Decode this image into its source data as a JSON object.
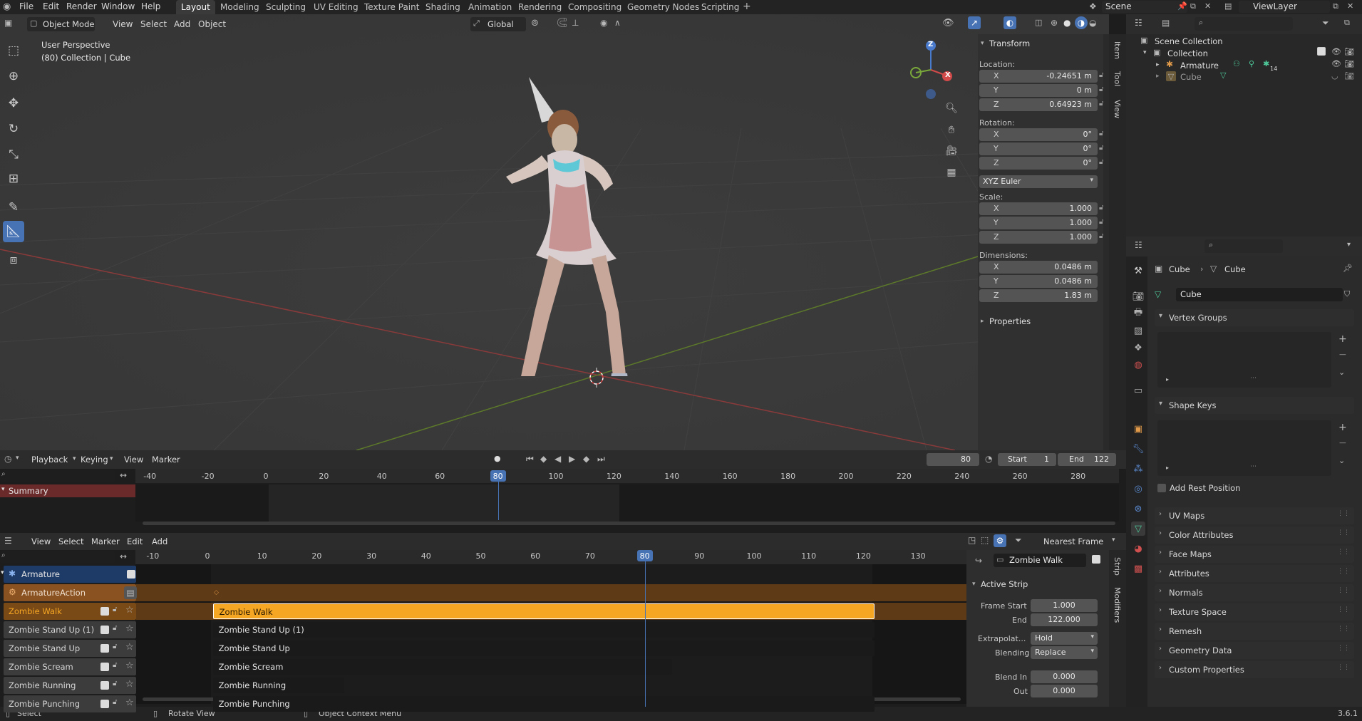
{
  "menu": [
    "File",
    "Edit",
    "Render",
    "Window",
    "Help"
  ],
  "workspaces": [
    "Layout",
    "Modeling",
    "Sculpting",
    "UV Editing",
    "Texture Paint",
    "Shading",
    "Animation",
    "Rendering",
    "Compositing",
    "Geometry Nodes",
    "Scripting"
  ],
  "active_workspace": "Layout",
  "scene": "Scene",
  "view_layer": "ViewLayer",
  "viewport": {
    "mode": "Object Mode",
    "menus": [
      "View",
      "Select",
      "Add",
      "Object"
    ],
    "orientation": "Global",
    "perspective": "User Perspective",
    "context": "(80) Collection | Cube",
    "gizmo": {
      "z": "Z",
      "x": "X"
    }
  },
  "npanel": {
    "tabs": [
      "Item",
      "Tool",
      "View"
    ],
    "transform_title": "Transform",
    "location_label": "Location:",
    "location": [
      {
        "axis": "X",
        "value": "-0.24651 m"
      },
      {
        "axis": "Y",
        "value": "0 m"
      },
      {
        "axis": "Z",
        "value": "0.64923 m"
      }
    ],
    "rotation_label": "Rotation:",
    "rotation": [
      {
        "axis": "X",
        "value": "0°"
      },
      {
        "axis": "Y",
        "value": "0°"
      },
      {
        "axis": "Z",
        "value": "0°"
      }
    ],
    "rotation_mode": "XYZ Euler",
    "scale_label": "Scale:",
    "scale": [
      {
        "axis": "X",
        "value": "1.000"
      },
      {
        "axis": "Y",
        "value": "1.000"
      },
      {
        "axis": "Z",
        "value": "1.000"
      }
    ],
    "dimensions_label": "Dimensions:",
    "dimensions": [
      {
        "axis": "X",
        "value": "0.0486 m"
      },
      {
        "axis": "Y",
        "value": "0.0486 m"
      },
      {
        "axis": "Z",
        "value": "1.83 m"
      }
    ],
    "properties_title": "Properties"
  },
  "outliner": {
    "scene_collection": "Scene Collection",
    "collection": "Collection",
    "armature": "Armature",
    "armature_badge": "14",
    "cube": "Cube"
  },
  "properties": {
    "breadcrumb_obj": "Cube",
    "breadcrumb_data": "Cube",
    "mesh_name": "Cube",
    "vertex_groups": "Vertex Groups",
    "shape_keys": "Shape Keys",
    "add_rest_position": "Add Rest Position",
    "sections": [
      "UV Maps",
      "Color Attributes",
      "Face Maps",
      "Attributes",
      "Normals",
      "Texture Space",
      "Remesh",
      "Geometry Data",
      "Custom Properties"
    ]
  },
  "timeline": {
    "menus": [
      "Playback",
      "Keying",
      "View",
      "Marker"
    ],
    "current_frame": "80",
    "start_label": "Start",
    "start": "1",
    "end_label": "End",
    "end": "122",
    "ruler": [
      "-40",
      "-20",
      "0",
      "20",
      "40",
      "60",
      "80",
      "100",
      "120",
      "140",
      "160",
      "180",
      "200",
      "220",
      "240",
      "260",
      "280"
    ],
    "summary": "Summary"
  },
  "nla": {
    "menus": [
      "View",
      "Select",
      "Marker",
      "Edit",
      "Add"
    ],
    "snap": "Nearest Frame",
    "ruler": [
      "-10",
      "0",
      "10",
      "20",
      "30",
      "40",
      "50",
      "60",
      "70",
      "80",
      "90",
      "100",
      "110",
      "120",
      "130"
    ],
    "current_frame": "80",
    "tracks": [
      {
        "name": "Armature"
      },
      {
        "name": "ArmatureAction"
      },
      {
        "name": "Zombie Walk"
      },
      {
        "name": "Zombie Stand Up (1)"
      },
      {
        "name": "Zombie Stand Up"
      },
      {
        "name": "Zombie Scream"
      },
      {
        "name": "Zombie Running"
      },
      {
        "name": "Zombie Punching"
      }
    ],
    "strips": [
      "Zombie Walk",
      "Zombie Stand Up (1)",
      "Zombie Stand Up",
      "Zombie Scream",
      "Zombie Running",
      "Zombie Punching"
    ],
    "sidebar": {
      "tabs": [
        "Strip",
        "Modifiers"
      ],
      "action_name": "Zombie Walk",
      "active_strip": "Active Strip",
      "frame_start_label": "Frame Start",
      "frame_start": "1.000",
      "end_label": "End",
      "end": "122.000",
      "extrapolation_label": "Extrapolat...",
      "extrapolation": "Hold",
      "blending_label": "Blending",
      "blending": "Replace",
      "blend_in_label": "Blend In",
      "blend_in": "0.000",
      "out_label": "Out",
      "out": "0.000"
    }
  },
  "status": {
    "select": "Select",
    "rotate": "Rotate View",
    "context": "Object Context Menu",
    "version": "3.6.1"
  },
  "colors": {
    "accent": "#4772b3",
    "strip_active": "#f5a623",
    "action_row": "#7a4a16",
    "summary_row": "#6b2a2a"
  }
}
